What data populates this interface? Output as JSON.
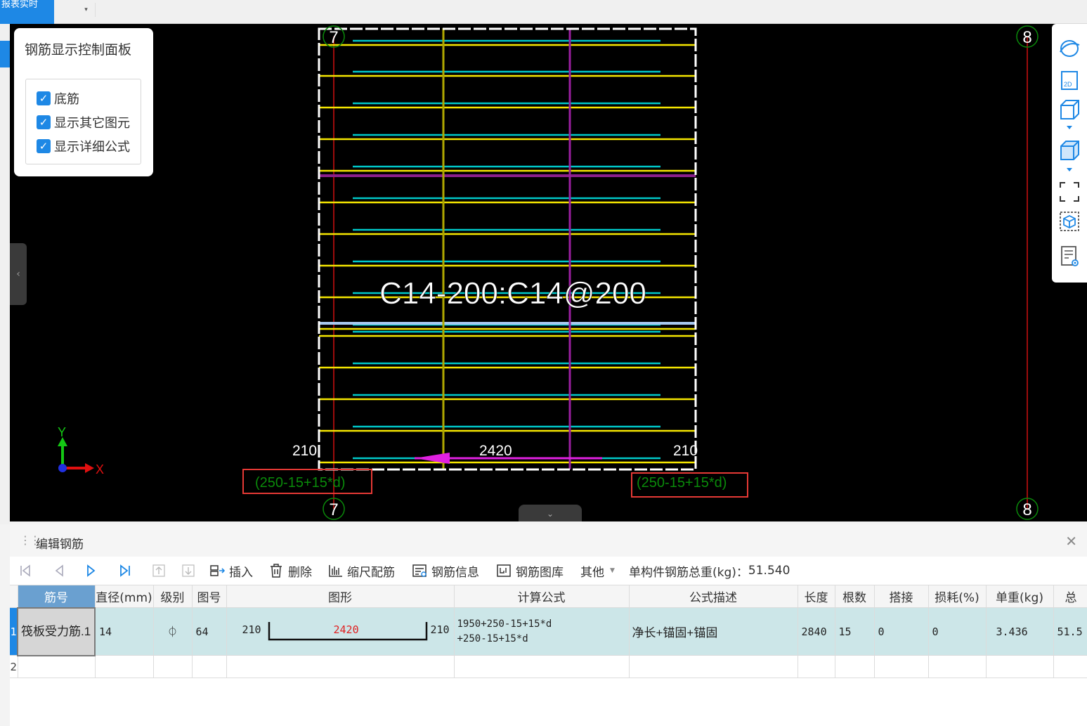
{
  "topbar": {
    "blue_tab_label": "报表实时",
    "dropdown_glyph": "▾"
  },
  "viewport": {
    "grid_labels": [
      "7",
      "7",
      "8",
      "8"
    ],
    "rebar_spec": "C14-200:C14@200",
    "dimensions": {
      "left": "210",
      "middle": "2420",
      "right": "210"
    },
    "formula_left": "(250-15+15*d)",
    "formula_right": "(250-15+15*d)",
    "axes": {
      "x": "X",
      "y": "Y"
    },
    "colors": {
      "cyan_bar": "#00c8c8",
      "yellow_bar": "#f5e600",
      "magenta_bar": "#c000c0",
      "white_outline": "#ffffff",
      "red_axis": "#d01010",
      "green_text": "#0a8a0a",
      "annotation_box": "#e53935"
    }
  },
  "control_panel": {
    "title": "钢筋显示控制面板",
    "options": [
      {
        "label": "底筋",
        "checked": true
      },
      {
        "label": "显示其它图元",
        "checked": true
      },
      {
        "label": "显示详细公式",
        "checked": true
      }
    ]
  },
  "right_toolbar": {
    "icons": [
      "orbit-icon",
      "view-2d-icon",
      "view-3d-box-icon",
      "dropdown-icon",
      "view-3d-solid-icon",
      "dropdown-icon",
      "fullscreen-icon",
      "select-box-icon",
      "report-view-icon"
    ],
    "view_2d_label": "2D"
  },
  "editor": {
    "title": "编辑钢筋",
    "close_glyph": "✕",
    "toolbar": {
      "insert": "插入",
      "delete": "删除",
      "scale_rebar": "缩尺配筋",
      "rebar_info": "钢筋信息",
      "rebar_library": "钢筋图库",
      "other": "其他",
      "total_weight_label": "单构件钢筋总重(kg)：",
      "total_weight_value": "51.540"
    },
    "columns": [
      "筋号",
      "直径(mm)",
      "级别",
      "图号",
      "图形",
      "计算公式",
      "公式描述",
      "长度",
      "根数",
      "搭接",
      "损耗(%)",
      "单重(kg)",
      "总"
    ],
    "rows": [
      {
        "num": "1",
        "name": "筏板受力筋.1",
        "diameter": "14",
        "grade": "⏀",
        "shape_no": "64",
        "shape_left": "210",
        "shape_mid": "2420",
        "shape_right": "210",
        "formula_line1": "1950+250-15+15*d",
        "formula_line2": "+250-15+15*d",
        "description": "净长+锚固+锚固",
        "length": "2840",
        "count": "15",
        "lap": "0",
        "loss": "0",
        "unit_weight": "3.436",
        "total": "51.5"
      },
      {
        "num": "2"
      }
    ]
  }
}
